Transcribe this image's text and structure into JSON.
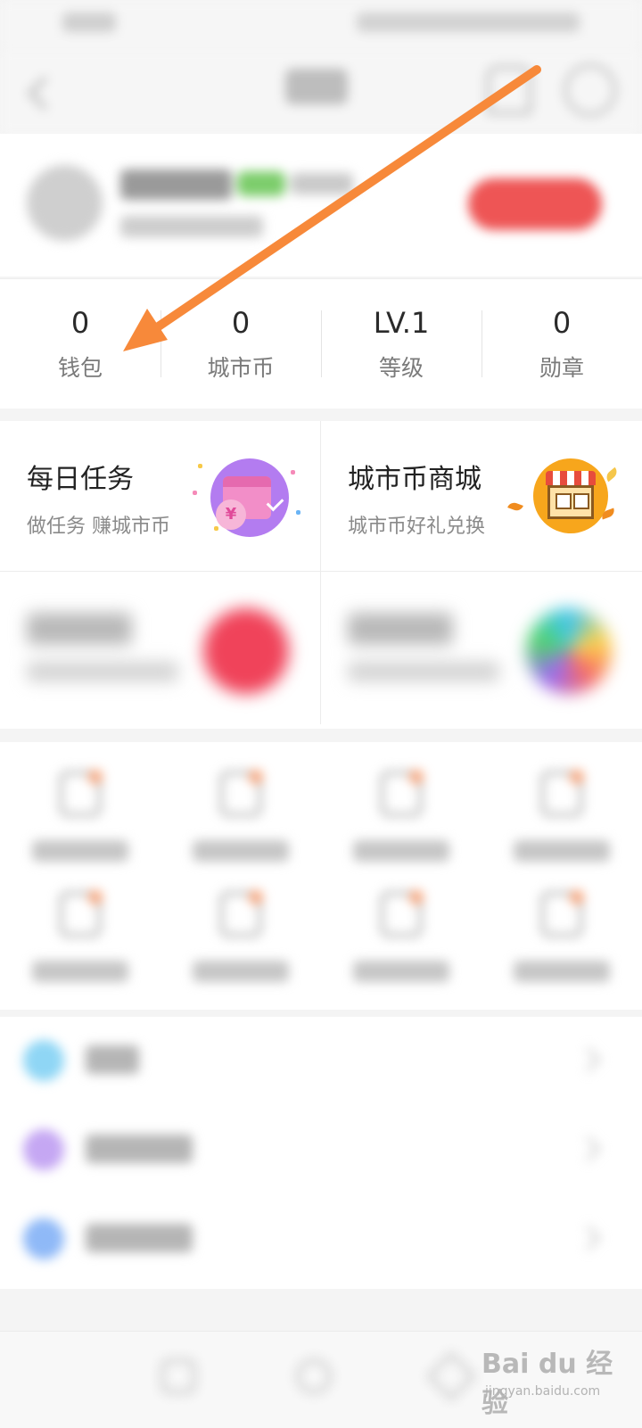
{
  "stats": [
    {
      "value": "0",
      "label": "钱包"
    },
    {
      "value": "0",
      "label": "城市币"
    },
    {
      "value": "LV.1",
      "label": "等级"
    },
    {
      "value": "0",
      "label": "勋章"
    }
  ],
  "cards": {
    "daily_task": {
      "title": "每日任务",
      "subtitle": "做任务 赚城市币",
      "icon": "calendar-coin-icon"
    },
    "coin_mall": {
      "title": "城市币商城",
      "subtitle": "城市币好礼兑换",
      "icon": "shop-icon"
    }
  },
  "watermark": {
    "brand": "Bai du 经验",
    "url": "jingyan.baidu.com"
  },
  "colors": {
    "annotation_arrow": "#f7893a",
    "sign_in_button": "#ee5555",
    "level_badge": "#7ccd6b",
    "task_icon_bg": "#b37cf0",
    "mall_icon_bg": "#f7a61c"
  }
}
